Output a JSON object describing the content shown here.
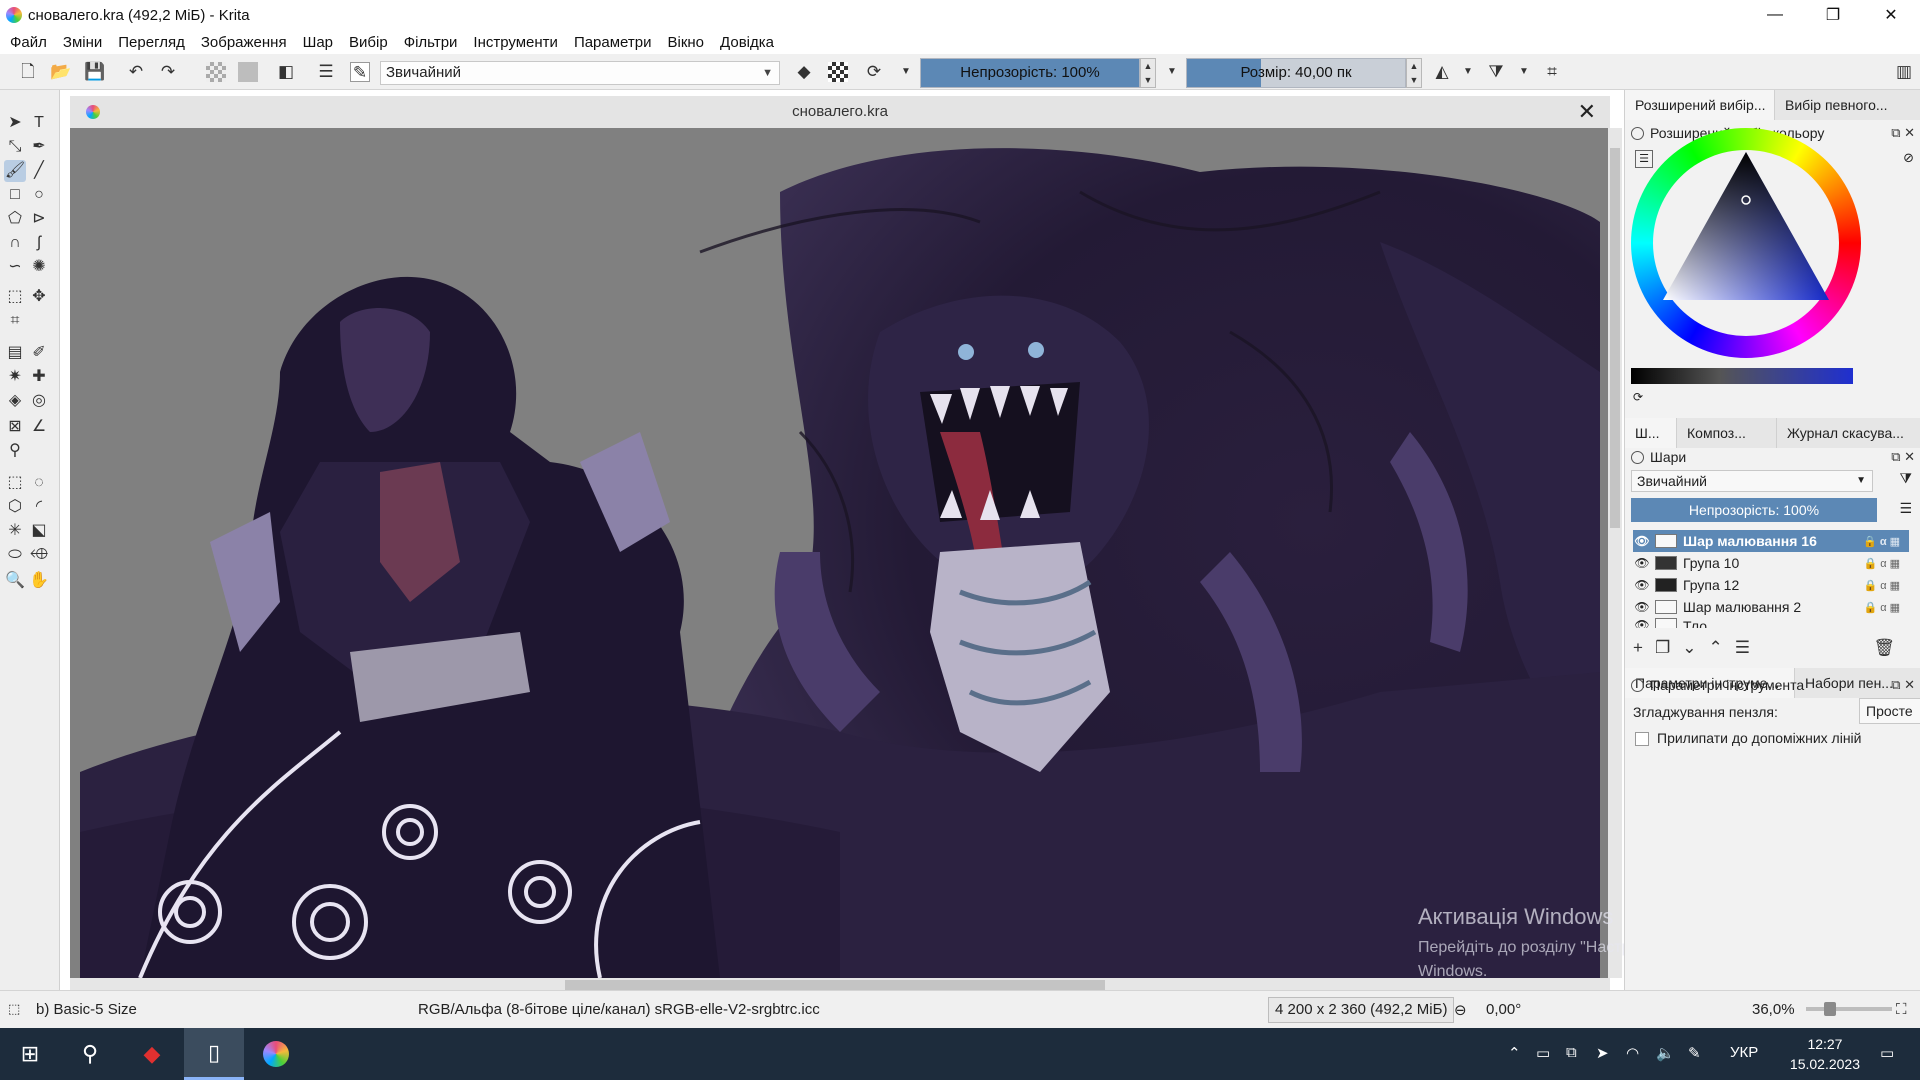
{
  "window": {
    "title": "сновалего.kra (492,2 МіБ)  - Krita",
    "controls": [
      "—",
      "❐",
      "✕"
    ]
  },
  "menu": [
    "Файл",
    "Зміни",
    "Перегляд",
    "Зображення",
    "Шар",
    "Вибір",
    "Фільтри",
    "Інструменти",
    "Параметри",
    "Вікно",
    "Довідка"
  ],
  "toolbar": {
    "blend_mode": "Звичайний",
    "opacity_label": "Непрозорість: 100%",
    "opacity_value": 100,
    "size_label": "Розмір: 40,00 пк"
  },
  "document": {
    "tab_title": "сновалего.kra"
  },
  "docker": {
    "top_tabs": [
      "Розширений вибір...",
      "Вибір певного..."
    ],
    "color_title": "Розширений вибір кольору",
    "middle_tabs": [
      "Ш...",
      "Композ...",
      "Журнал скасува..."
    ],
    "layers_title": "Шари",
    "layers_blend": "Звичайний",
    "layers_opacity": "Непрозорість:  100%",
    "layers": [
      {
        "name": "Шар малювання 16",
        "active": true
      },
      {
        "name": "Група 10",
        "active": false
      },
      {
        "name": "Група 12",
        "active": false
      },
      {
        "name": "Шар малювання 2",
        "active": false
      },
      {
        "name": "Тло",
        "active": false
      }
    ],
    "bottom_tabs": [
      "Параметри інструме...",
      "Набори пен..."
    ],
    "tool_options_title": "Параметри інструмента",
    "smoothing_label": "Згладжування пензля:",
    "smoothing_value": "Просте",
    "snap_label": "Прилипати до допоміжних ліній"
  },
  "watermark": {
    "title": "Активація Windows",
    "body": "Перейдіть до розділу \"Настройки\", щоб активувати Windows."
  },
  "status": {
    "brush": "b) Basic-5 Size",
    "colorspace": "RGB/Альфа (8-бітове ціле/канал)  sRGB-elle-V2-srgbtrc.icc",
    "dimensions": "4 200 x 2 360 (492,2 МіБ)",
    "rotation": "0,00°",
    "zoom": "36,0%"
  },
  "taskbar": {
    "lang": "УКР",
    "time": "12:27",
    "date": "15.02.2023"
  }
}
